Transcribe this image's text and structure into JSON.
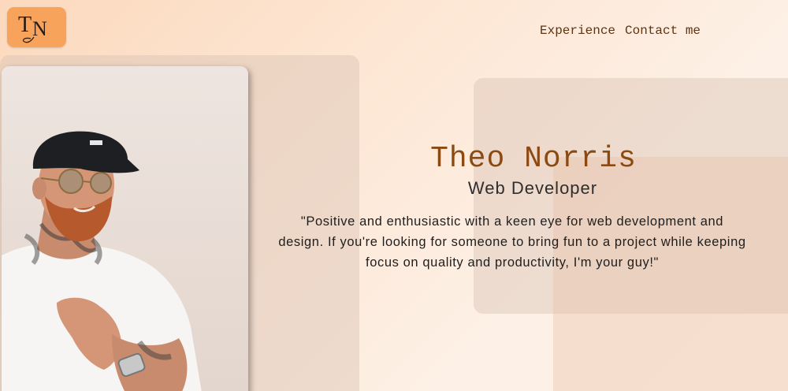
{
  "logo": {
    "text": "TN",
    "color": "#f7a35c"
  },
  "nav": {
    "items": [
      {
        "label": "Experience"
      },
      {
        "label": "Contact me"
      }
    ]
  },
  "hero": {
    "name": "Theo Norris",
    "role": "Web Developer",
    "bio": "\"Positive and enthusiastic with a keen eye for web development and design. If you're looking for someone to bring fun to a project while keeping focus on quality and productivity, I'm your guy!\"",
    "photo": "profile-photo"
  },
  "colors": {
    "name": "#8b4a12",
    "nav": "#5e3412",
    "accent": "#f7a35c"
  }
}
